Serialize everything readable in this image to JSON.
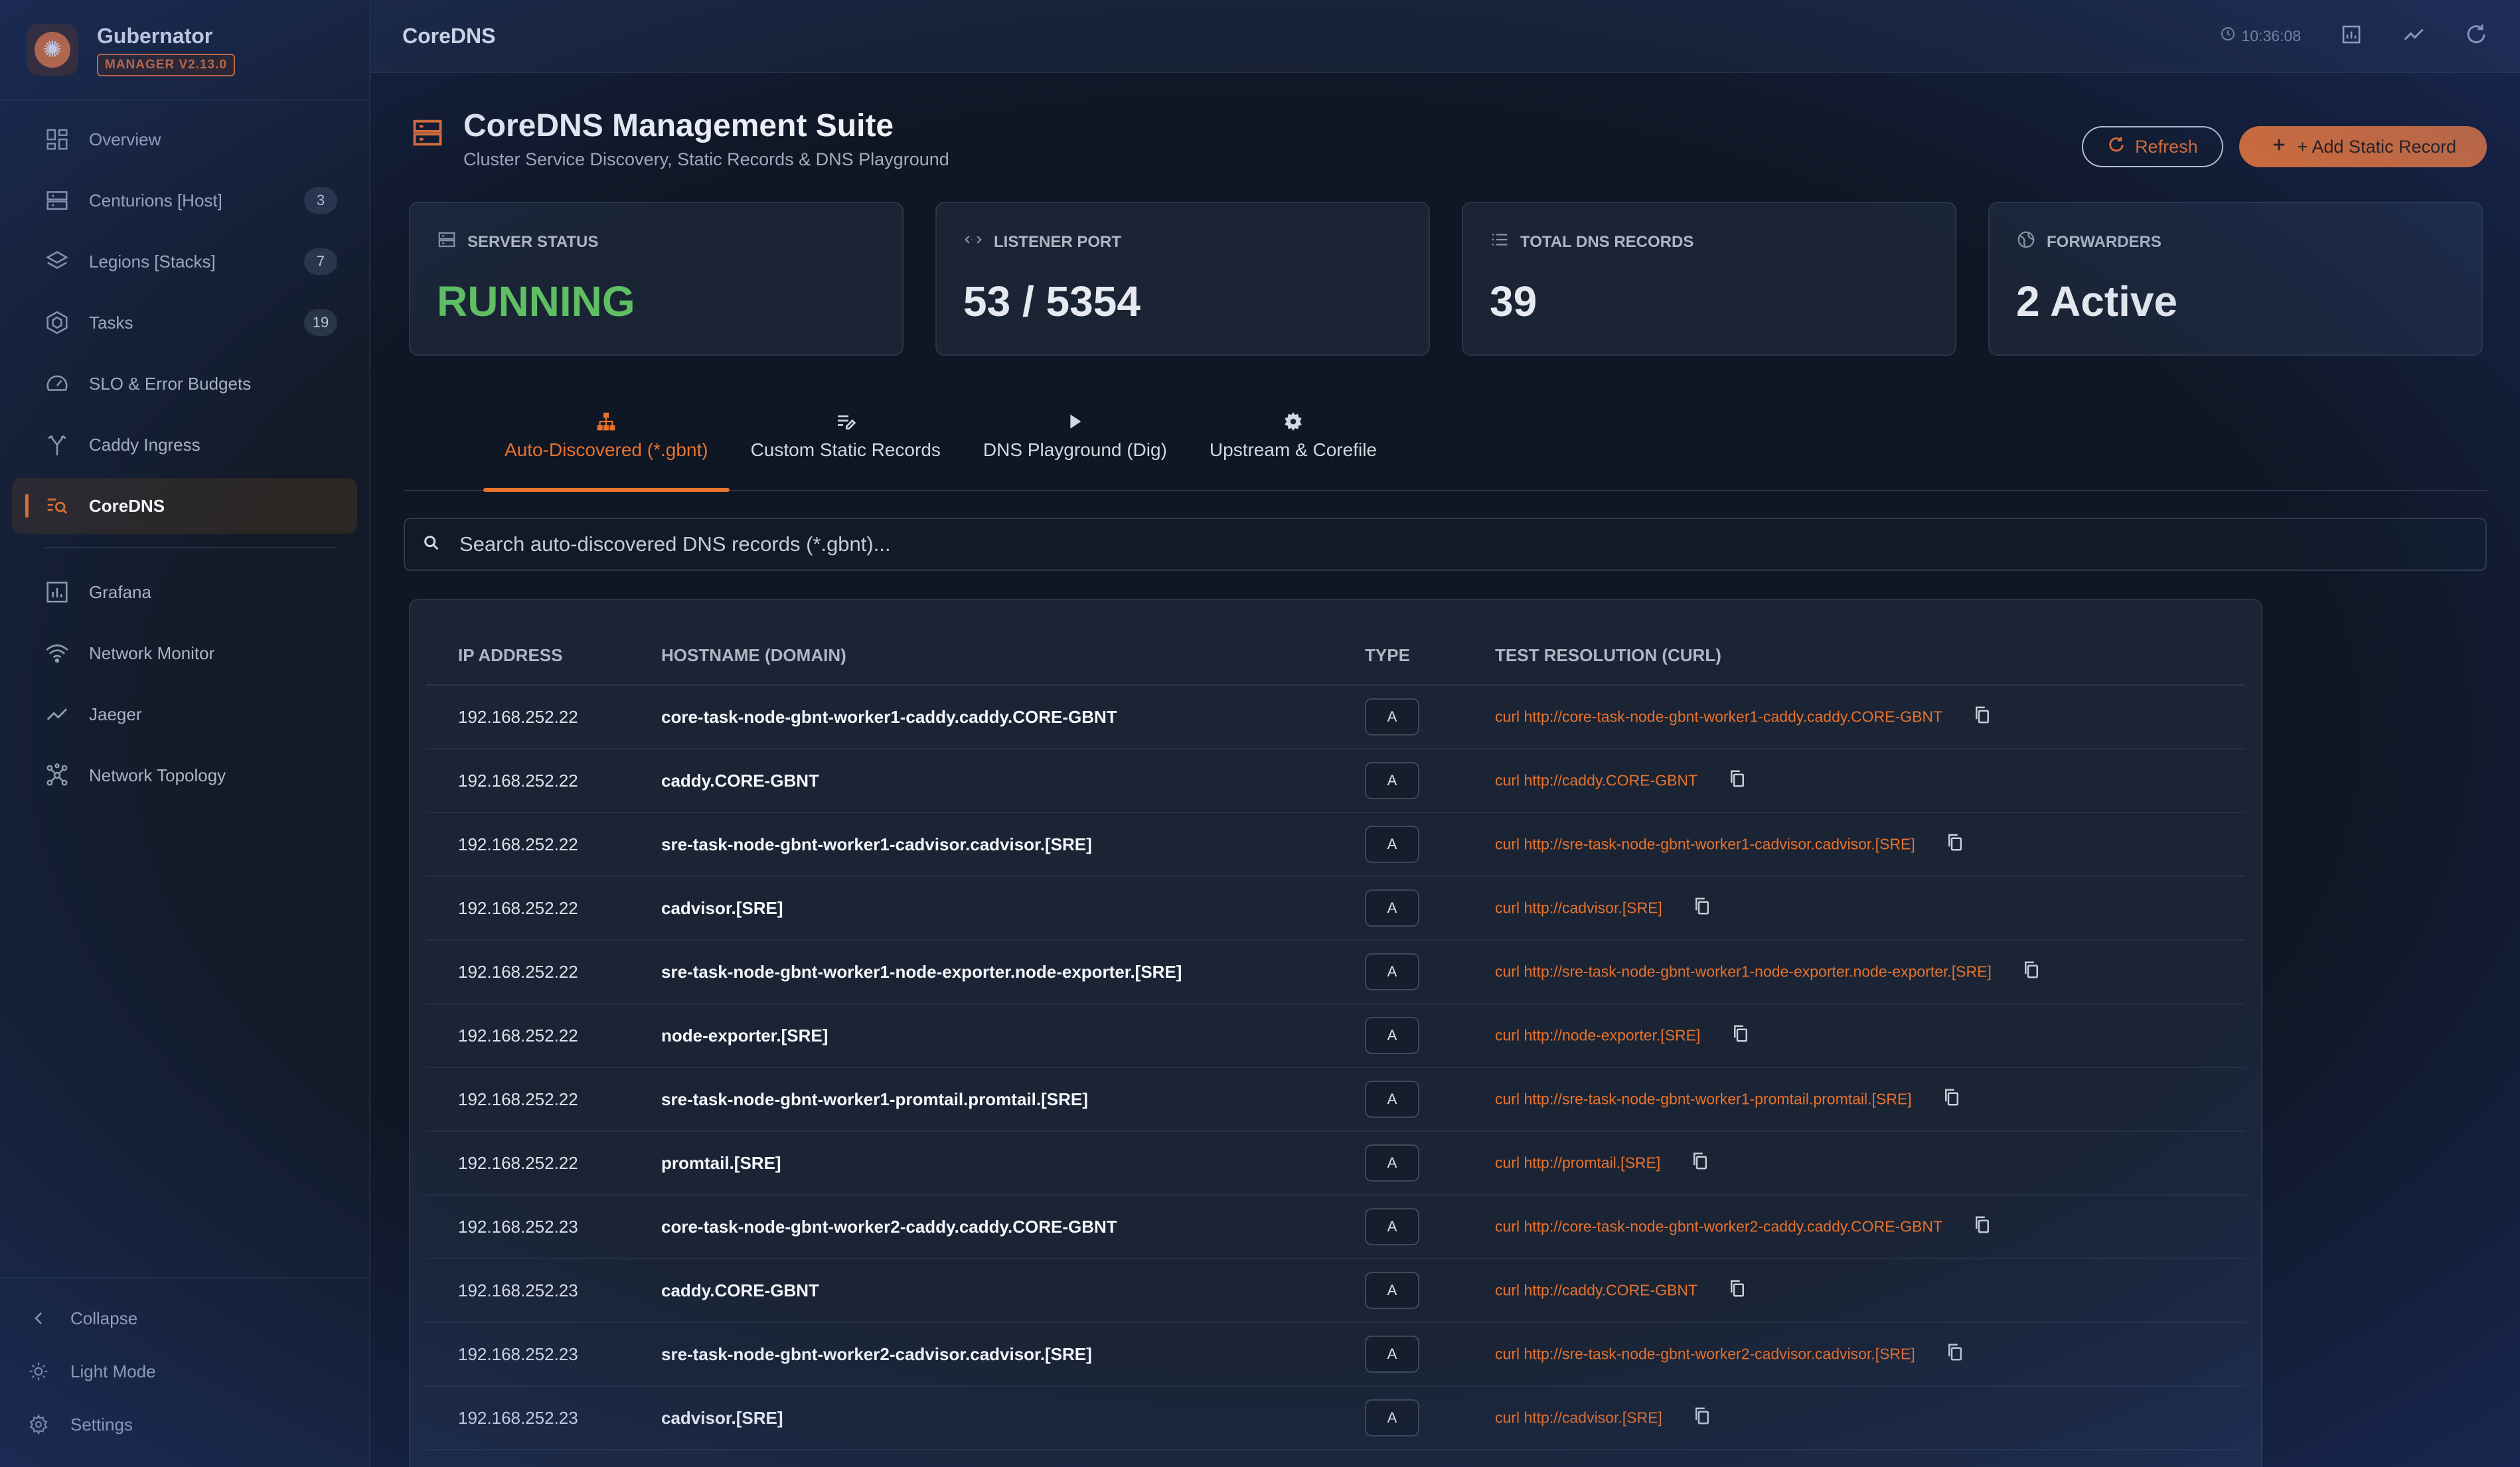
{
  "app": {
    "name": "Gubernator",
    "version_badge": "MANAGER V2.13.0",
    "logo_glyph": "✺"
  },
  "sidebar": {
    "items": [
      {
        "label": "Overview",
        "icon": "dashboard-icon",
        "count": ""
      },
      {
        "label": "Centurions [Host]",
        "icon": "server-icon",
        "count": "3"
      },
      {
        "label": "Legions [Stacks]",
        "icon": "layers-icon",
        "count": "7"
      },
      {
        "label": "Tasks",
        "icon": "hexagon-icon",
        "count": "19"
      },
      {
        "label": "SLO & Error Budgets",
        "icon": "gauge-icon",
        "count": ""
      },
      {
        "label": "Caddy Ingress",
        "icon": "fork-icon",
        "count": ""
      },
      {
        "label": "CoreDNS",
        "icon": "dns-search-icon",
        "count": "",
        "active": true
      }
    ],
    "secondary_items": [
      {
        "label": "Grafana",
        "icon": "chart-icon"
      },
      {
        "label": "Network Monitor",
        "icon": "wifi-icon"
      },
      {
        "label": "Jaeger",
        "icon": "trend-icon"
      },
      {
        "label": "Network Topology",
        "icon": "topology-icon"
      }
    ],
    "bottom": {
      "collapse": "Collapse",
      "light_mode": "Light Mode",
      "settings": "Settings"
    }
  },
  "topbar": {
    "title": "CoreDNS",
    "time": "10:36:08"
  },
  "page": {
    "title": "CoreDNS Management Suite",
    "subtitle": "Cluster Service Discovery, Static Records & DNS Playground",
    "refresh_label": "Refresh",
    "add_label": "+ Add Static Record"
  },
  "stats": [
    {
      "label": "SERVER STATUS",
      "value": "RUNNING",
      "icon": "server-status-icon",
      "color": "#5fbf63"
    },
    {
      "label": "LISTENER PORT",
      "value": "53 / 5354",
      "icon": "code-arrows-icon"
    },
    {
      "label": "TOTAL DNS RECORDS",
      "value": "39",
      "icon": "list-icon"
    },
    {
      "label": "FORWARDERS",
      "value": "2 Active",
      "icon": "globe-icon"
    }
  ],
  "tabs": [
    {
      "label": "Auto-Discovered (*.gbnt)",
      "icon": "hierarchy-icon",
      "active": true
    },
    {
      "label": "Custom Static Records",
      "icon": "edit-list-icon"
    },
    {
      "label": "DNS Playground (Dig)",
      "icon": "play-icon"
    },
    {
      "label": "Upstream & Corefile",
      "icon": "gear-icon"
    }
  ],
  "search": {
    "placeholder": "Search auto-discovered DNS records (*.gbnt)..."
  },
  "table": {
    "columns": [
      "IP ADDRESS",
      "HOSTNAME (DOMAIN)",
      "TYPE",
      "TEST RESOLUTION (CURL)"
    ],
    "rows": [
      {
        "ip": "192.168.252.22",
        "host": "core-task-node-gbnt-worker1-caddy.caddy.CORE-GBNT",
        "type": "A",
        "curl": "curl http://core-task-node-gbnt-worker1-caddy.caddy.CORE-GBNT"
      },
      {
        "ip": "192.168.252.22",
        "host": "caddy.CORE-GBNT",
        "type": "A",
        "curl": "curl http://caddy.CORE-GBNT"
      },
      {
        "ip": "192.168.252.22",
        "host": "sre-task-node-gbnt-worker1-cadvisor.cadvisor.[SRE]",
        "type": "A",
        "curl": "curl http://sre-task-node-gbnt-worker1-cadvisor.cadvisor.[SRE]"
      },
      {
        "ip": "192.168.252.22",
        "host": "cadvisor.[SRE]",
        "type": "A",
        "curl": "curl http://cadvisor.[SRE]"
      },
      {
        "ip": "192.168.252.22",
        "host": "sre-task-node-gbnt-worker1-node-exporter.node-exporter.[SRE]",
        "type": "A",
        "curl": "curl http://sre-task-node-gbnt-worker1-node-exporter.node-exporter.[SRE]"
      },
      {
        "ip": "192.168.252.22",
        "host": "node-exporter.[SRE]",
        "type": "A",
        "curl": "curl http://node-exporter.[SRE]"
      },
      {
        "ip": "192.168.252.22",
        "host": "sre-task-node-gbnt-worker1-promtail.promtail.[SRE]",
        "type": "A",
        "curl": "curl http://sre-task-node-gbnt-worker1-promtail.promtail.[SRE]"
      },
      {
        "ip": "192.168.252.22",
        "host": "promtail.[SRE]",
        "type": "A",
        "curl": "curl http://promtail.[SRE]"
      },
      {
        "ip": "192.168.252.23",
        "host": "core-task-node-gbnt-worker2-caddy.caddy.CORE-GBNT",
        "type": "A",
        "curl": "curl http://core-task-node-gbnt-worker2-caddy.caddy.CORE-GBNT"
      },
      {
        "ip": "192.168.252.23",
        "host": "caddy.CORE-GBNT",
        "type": "A",
        "curl": "curl http://caddy.CORE-GBNT"
      },
      {
        "ip": "192.168.252.23",
        "host": "sre-task-node-gbnt-worker2-cadvisor.cadvisor.[SRE]",
        "type": "A",
        "curl": "curl http://sre-task-node-gbnt-worker2-cadvisor.cadvisor.[SRE]"
      },
      {
        "ip": "192.168.252.23",
        "host": "cadvisor.[SRE]",
        "type": "A",
        "curl": "curl http://cadvisor.[SRE]"
      }
    ]
  },
  "colors": {
    "accent": "#e8722c",
    "status_running": "#5fbf63",
    "background": "#0f1624",
    "card": "#1a2435"
  }
}
